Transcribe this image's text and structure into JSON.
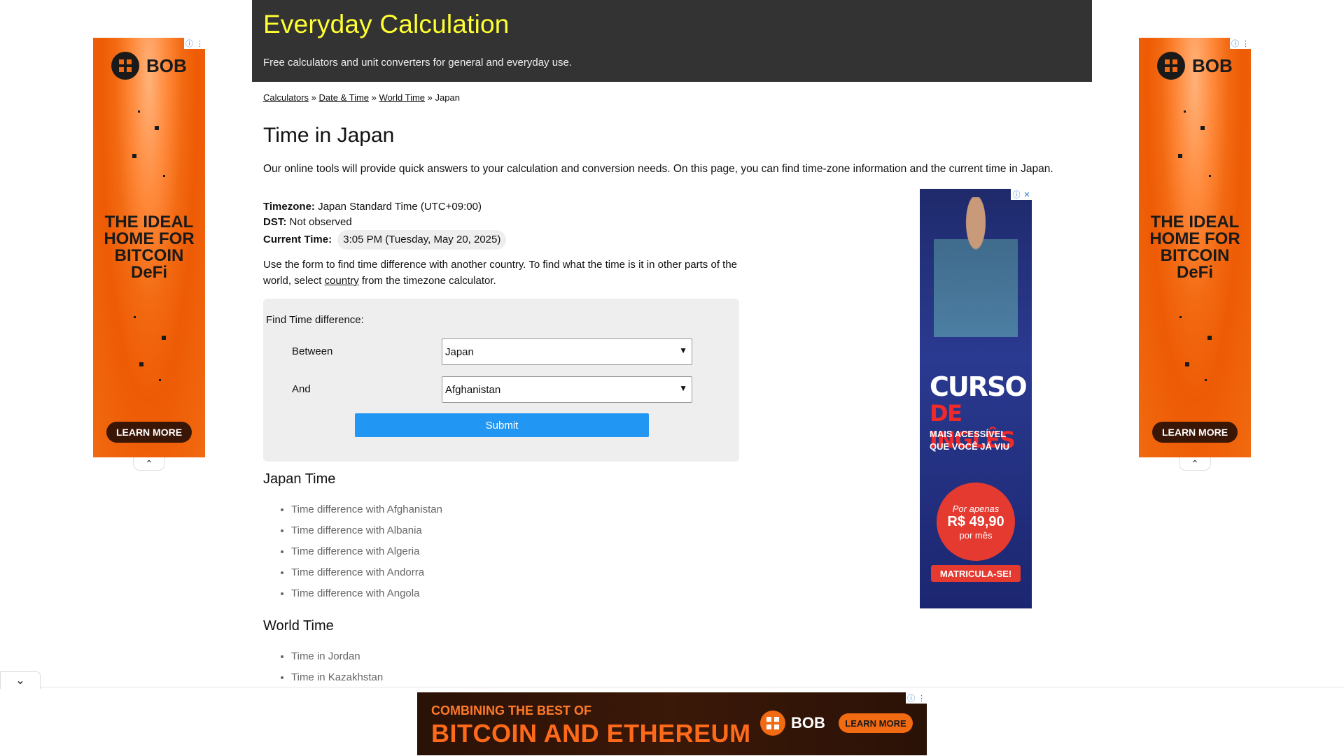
{
  "header": {
    "title": "Everyday Calculation",
    "tagline": "Free calculators and unit converters for general and everyday use."
  },
  "breadcrumb": {
    "items": [
      "Calculators",
      "Date & Time",
      "World Time"
    ],
    "separator": "»",
    "current": "Japan"
  },
  "page": {
    "title": "Time in Japan",
    "intro": "Our online tools will provide quick answers to your calculation and conversion needs. On this page, you can find time-zone information and the current time in Japan."
  },
  "info": {
    "timezone_label": "Timezone:",
    "timezone_value": "Japan Standard Time (UTC+09:00)",
    "dst_label": "DST:",
    "dst_value": "Not observed",
    "current_time_label": "Current Time:",
    "current_time_value": "3:05 PM (Tuesday, May 20, 2025)"
  },
  "form_note": {
    "before": "Use the form to find time difference with another country. To find what the time is it in other parts of the world, select ",
    "link": "country",
    "after": " from the timezone calculator."
  },
  "form": {
    "heading": "Find Time difference:",
    "between_label": "Between",
    "between_value": "Japan",
    "and_label": "And",
    "and_value": "Afghanistan",
    "submit_label": "Submit"
  },
  "japan_time": {
    "heading": "Japan Time",
    "links": [
      "Time difference with Afghanistan",
      "Time difference with Albania",
      "Time difference with Algeria",
      "Time difference with Andorra",
      "Time difference with Angola"
    ]
  },
  "world_time": {
    "heading": "World Time",
    "links": [
      "Time in Jordan",
      "Time in Kazakhstan"
    ]
  },
  "ads": {
    "side": {
      "brand": "BOB",
      "headline_lines": [
        "THE IDEAL",
        "HOME FOR",
        "BITCOIN",
        "DeFi"
      ],
      "cta": "LEARN MORE"
    },
    "center": {
      "line1": "CURSO",
      "line2": "DE INGLÊS",
      "line3": "MAIS ACESSÍVEL",
      "line4": "QUE VOCÊ JÁ VIU",
      "price_pre": "Por apenas",
      "price": "R$ 49,90",
      "price_post": "por mês",
      "cta": "MATRICULA-SE!"
    },
    "bottom": {
      "line1": "COMBINING THE BEST OF",
      "line2": "BITCOIN AND ETHEREUM",
      "brand": "BOB",
      "cta": "LEARN MORE"
    }
  },
  "colors": {
    "header_bg": "#333333",
    "title_yellow": "#ffff33",
    "submit_blue": "#2196f3",
    "form_bg": "#eeeeee",
    "ad_orange": "#f26a12"
  }
}
